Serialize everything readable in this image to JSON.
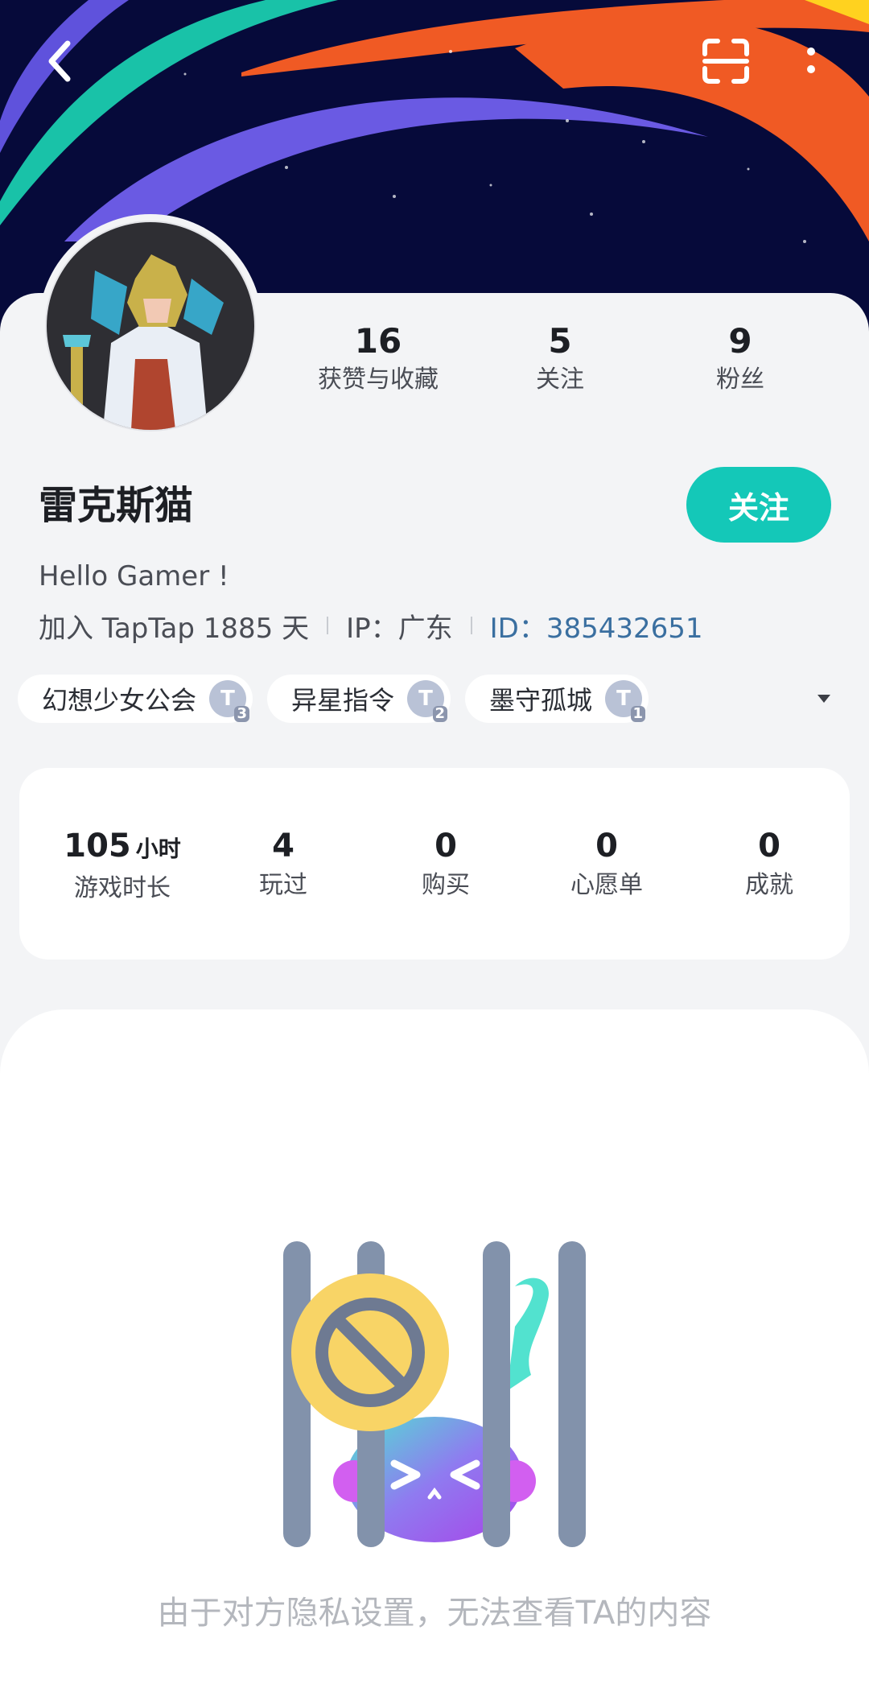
{
  "header": {
    "back_icon": "chevron-left-icon",
    "scan_icon": "scan-icon",
    "more_icon": "more-vertical-icon"
  },
  "profile": {
    "name": "雷克斯猫",
    "follow_label": "关注",
    "bio": "Hello Gamer !",
    "joined": "加入 TapTap 1885 天",
    "ip": "IP：广东",
    "uid": "ID：385432651",
    "accent_color": "#14c8b8"
  },
  "stats": [
    {
      "value": "16",
      "label": "获赞与收藏"
    },
    {
      "value": "5",
      "label": "关注"
    },
    {
      "value": "9",
      "label": "粉丝"
    }
  ],
  "guilds": [
    {
      "name": "幻想少女公会",
      "level": "3"
    },
    {
      "name": "异星指令",
      "level": "2"
    },
    {
      "name": "墨守孤城",
      "level": "1"
    }
  ],
  "game_stats": [
    {
      "value": "105",
      "unit": "小时",
      "label": "游戏时长"
    },
    {
      "value": "4",
      "label": "玩过"
    },
    {
      "value": "0",
      "label": "购买"
    },
    {
      "value": "0",
      "label": "心愿单"
    },
    {
      "value": "0",
      "label": "成就"
    }
  ],
  "privacy": {
    "message": "由于对方隐私设置，无法查看TA的内容"
  }
}
